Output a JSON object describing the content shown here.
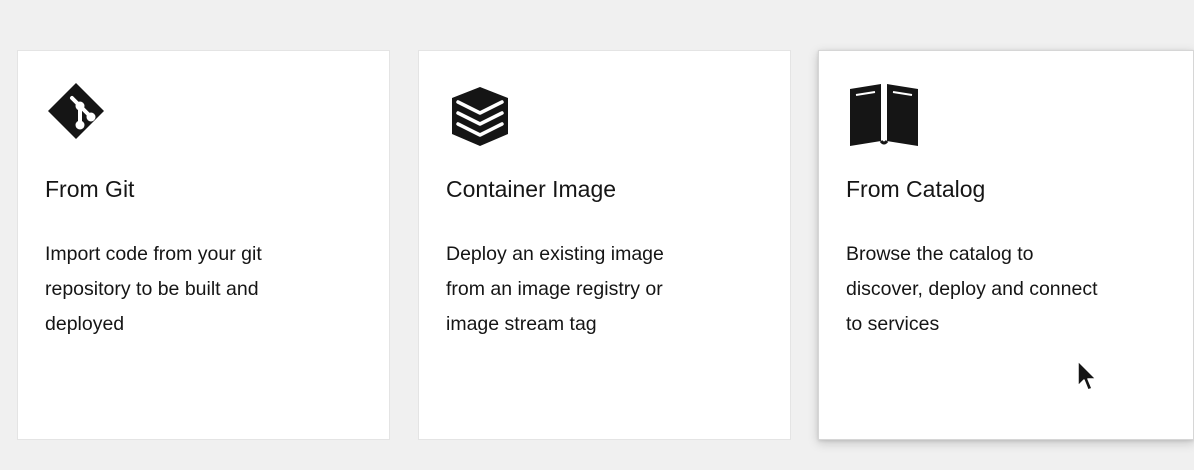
{
  "cards": [
    {
      "icon": "git-icon",
      "title": "From Git",
      "description_lines": [
        "Import code from your git",
        "repository to be built and",
        "deployed"
      ]
    },
    {
      "icon": "layers-icon",
      "title": "Container Image",
      "description_lines": [
        "Deploy an existing image",
        "from an image registry or",
        "image stream tag"
      ]
    },
    {
      "icon": "book-icon",
      "title": "From Catalog",
      "description_lines": [
        "Browse the catalog to",
        "discover, deploy and connect",
        "to services"
      ]
    }
  ],
  "colors": {
    "page_background": "#f0f0f0",
    "card_background": "#ffffff",
    "text": "#151515",
    "icon": "#151515"
  }
}
